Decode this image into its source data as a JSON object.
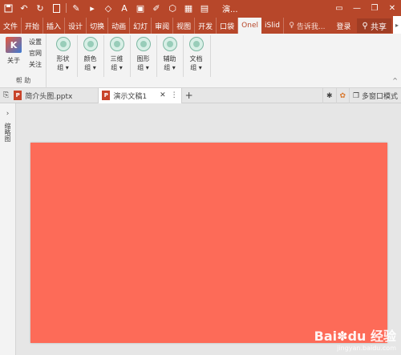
{
  "titlebar": {
    "title": "演...",
    "qat": [
      "save-icon",
      "undo-icon",
      "redo-icon",
      "new-icon",
      "pen-icon",
      "paint-icon",
      "font-color-icon",
      "shape-icon",
      "arrange-icon",
      "pen2-icon",
      "select-icon",
      "table-icon",
      "layout-icon"
    ]
  },
  "tabs": {
    "items": [
      "文件",
      "开始",
      "插入",
      "设计",
      "切换",
      "动画",
      "幻灯",
      "审阅",
      "视图",
      "开发",
      "口袋",
      "Onel",
      "iSlid"
    ],
    "active": "Onel",
    "tell_me": "告诉我...",
    "login": "登录",
    "share": "共享"
  },
  "ribbon": {
    "help_group": {
      "about": "关于",
      "items": [
        "设置",
        "官网",
        "关注"
      ],
      "label": "帮 助"
    },
    "groups": [
      {
        "line1": "形状",
        "line2": "组 ▾"
      },
      {
        "line1": "颜色",
        "line2": "组 ▾"
      },
      {
        "line1": "三维",
        "line2": "组 ▾"
      },
      {
        "line1": "图形",
        "line2": "组 ▾"
      },
      {
        "line1": "辅助",
        "line2": "组 ▾"
      },
      {
        "line1": "文档",
        "line2": "组 ▾"
      }
    ],
    "collapse": "^"
  },
  "docbar": {
    "tabs": [
      {
        "label": "简介头图.pptx"
      },
      {
        "label": "演示文稿1"
      }
    ],
    "multi_window": "多窗口模式"
  },
  "leftpane": {
    "vertical_label": "缩略图"
  },
  "watermark": {
    "text": "Bai",
    "paw": "du",
    "suffix": "经验",
    "url": "jingyan.baidu.com"
  },
  "colors": {
    "accent": "#b7472a",
    "slide": "#fd6b58"
  }
}
